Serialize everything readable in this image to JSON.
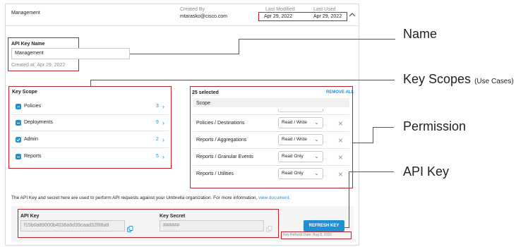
{
  "header": {
    "name": "Management",
    "created_by_label": "Created By",
    "created_by_value": "mtarasko@cisco.com",
    "last_modified_label": "Last Modified",
    "last_modified_value": "Apr 29, 2022",
    "last_used_label": "Last Used",
    "last_used_value": "Apr 29, 2022"
  },
  "name_section": {
    "label": "API Key Name",
    "value": "Management",
    "created_at": "Created at: Apr 29, 2022"
  },
  "key_scope": {
    "title": "Key Scope",
    "items": [
      {
        "label": "Policies",
        "count": "3",
        "checked": "partial"
      },
      {
        "label": "Deployments",
        "count": "9",
        "checked": "partial"
      },
      {
        "label": "Admin",
        "count": "2",
        "checked": "checked"
      },
      {
        "label": "Reports",
        "count": "5",
        "checked": "partial"
      }
    ]
  },
  "selected_panel": {
    "count_label": "25 selected",
    "remove_all": "REMOVE ALL",
    "scope_header": "Scope",
    "rows": [
      {
        "scope": "Policies / Destinations",
        "permission": "Read / Write"
      },
      {
        "scope": "Reports / Aggregations",
        "permission": "Read / Write"
      },
      {
        "scope": "Reports / Granular Events",
        "permission": "Read Only"
      },
      {
        "scope": "Reports / Utilities",
        "permission": "Read Only"
      }
    ]
  },
  "info": {
    "text": "The API Key and secret here are used to perform API requests against your Umbrella organization. For more information, ",
    "link": "view document."
  },
  "api_key": {
    "key_label": "API Key",
    "key_value": "f15b0a89000b4036a8d39caad32f88a8",
    "secret_label": "Key Secret",
    "secret_value": "######",
    "refresh_button": "REFRESH KEY",
    "refresh_date": "Key Refresh Date: Aug 8, 2022"
  },
  "annotations": {
    "name": "Name",
    "key_scopes": "Key Scopes",
    "key_scopes_sub": "(Use Cases)",
    "permission": "Permission",
    "api_key": "API Key"
  },
  "colors": {
    "accent": "#1f8fd6",
    "highlight": "#b8252b"
  }
}
